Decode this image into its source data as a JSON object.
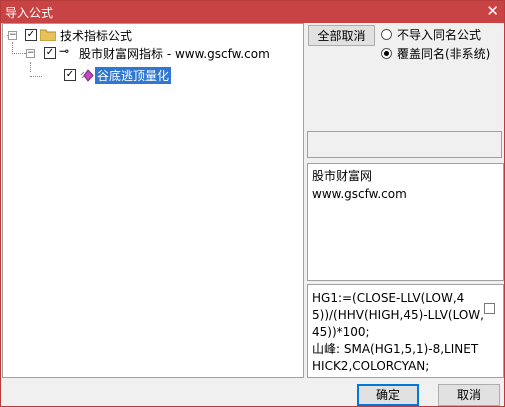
{
  "window": {
    "title": "导入公式",
    "close_glyph": "✕"
  },
  "tree": {
    "root": {
      "label": "技术指标公式",
      "checked": true,
      "expander": "−"
    },
    "group": {
      "label": "股市财富网指标 - www.gscfw.com",
      "checked": true,
      "expander": "−"
    },
    "item": {
      "label": "谷底逃顶量化",
      "checked": true,
      "selected": true
    }
  },
  "options": {
    "cancel_all_label": "全部取消",
    "radio_no_import_label": "不导入同名公式",
    "radio_overwrite_label": "覆盖同名(非系统)",
    "selected_option": "overwrite"
  },
  "description": {
    "line1": "股市财富网",
    "line2": "www.gscfw.com"
  },
  "code": {
    "text": "HG1:=(CLOSE-LLV(LOW,45))/(HHV(HIGH,45)-LLV(LOW,45))*100;\n山峰: SMA(HG1,5,1)-8,LINETHICK2,COLORCYAN;",
    "checked": false
  },
  "footer": {
    "ok_label": "确定",
    "cancel_label": "取消"
  },
  "colors": {
    "titlebar": "#c84343",
    "selection": "#2f77d1",
    "folder": "#e8c15a",
    "gem": "#c04bc0"
  }
}
